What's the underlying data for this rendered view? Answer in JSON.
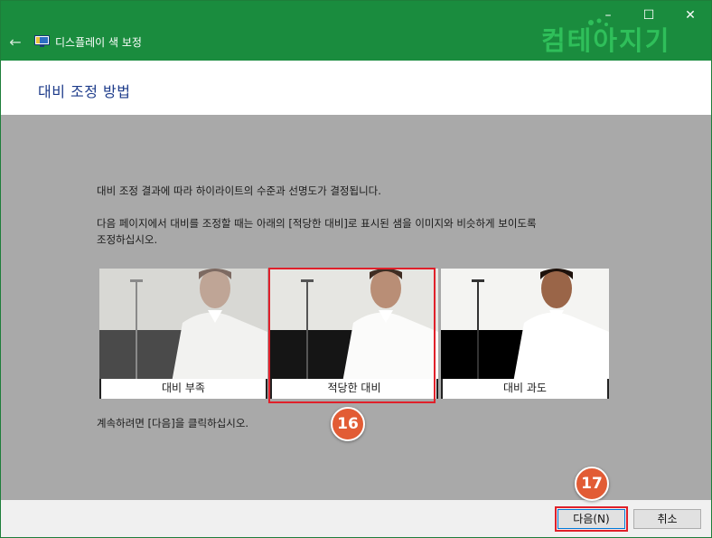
{
  "window": {
    "title": "디스플레이 색 보정",
    "back_icon": "back-arrow-icon",
    "controls": {
      "minimize": "–",
      "maximize": "☐",
      "close": "✕"
    },
    "watermark": "컴테아지기"
  },
  "header": {
    "title": "대비 조정 방법"
  },
  "main": {
    "para1": "대비 조정 결과에 따라 하이라이트의 수준과 선명도가 결정됩니다.",
    "para2_line1": "다음 페이지에서 대비를 조정할 때는 아래의 [적당한 대비]로 표시된 샘을 이미지와 비슷하게 보이도록",
    "para2_line2": "조정하십시오.",
    "samples": [
      {
        "caption": "대비 부족"
      },
      {
        "caption": "적당한 대비"
      },
      {
        "caption": "대비 과도"
      }
    ],
    "para3": "계속하려면 [다음]을 클릭하십시오."
  },
  "annotations": {
    "badge_a": "16",
    "badge_b": "17"
  },
  "footer": {
    "next_label": "다음(N)",
    "cancel_label": "취소"
  },
  "colors": {
    "titlebar": "#1a8c3e",
    "content_bg": "#a9a9a9",
    "title_text": "#1d3b8a",
    "highlight": "#e0202a",
    "badge": "#e25c35"
  }
}
